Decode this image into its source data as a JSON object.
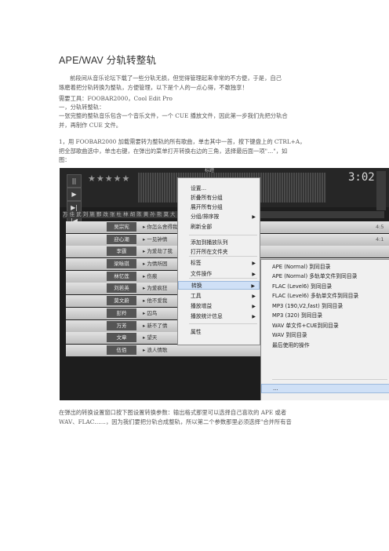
{
  "title": "APE/WAV 分轨转整轨",
  "paragraphs": {
    "p1_a": "前段间从音乐论坛下载了一些分轨无损，但觉得管理起来非常的不方便，于是，自己",
    "p1_b": "琢磨着把分轨转换为整轨，方便管理，以下是个人的一点心得，不敢独享！",
    "tools": "需要工具：FOOBAR2000，Cool Edit Pro",
    "step1": "一，分轨转整轨：",
    "p3_a": "一张完整的整轨音乐包含一个音乐文件，一个 CUE 播放文件，因此第一步我们先把分轨合",
    "p3_b": "并，再制作 CUE 文件。",
    "p4_a": "1，用 FOOBAR2000 加载需要转为整轨的所有歌曲，单击其中一首，按下键盘上的 CTRL+A，",
    "p4_b": "把全部歌曲选中，单击右键，在弹出的菜单打开转换右边的三角，选择最后面一项\"…\"，如",
    "p4_c": "图：",
    "after_a": "在弹出的转换设置窗口按下图设置转换参数：输出格式那里可以选择自己喜欢的 APE 或者",
    "after_b": "WAV、FLAC……，因为我们要把分轨合成整轨，所以第二个参数那里必须选择\"合并所有音"
  },
  "player": {
    "time": "3:02",
    "stars": "★★★★★",
    "top_label": "标题",
    "controls": [
      "||",
      "▶",
      "▶|",
      "|◀"
    ],
    "tabs": "万 佳 武 刘 施 鄞 改 张 杜 林 胡 陈 黄 孙 熊 莫 大 宋 李",
    "tracks": [
      {
        "artist": "吴宗宪",
        "song": "你怎么舍得我难过",
        "duration": "4:5"
      },
      {
        "artist": "迎心潮",
        "song": "一见钟情",
        "duration": "4:1"
      },
      {
        "artist": "李霆",
        "song": "为爱劫了我",
        "duration": ""
      },
      {
        "artist": "梁咏琪",
        "song": "为情所困",
        "duration": ""
      },
      {
        "artist": "林忆莲",
        "song": "伤痕",
        "duration": ""
      },
      {
        "artist": "刘若英",
        "song": "为爱疯狂",
        "duration": ""
      },
      {
        "artist": "莫文蔚",
        "song": "他不爱我",
        "duration": ""
      },
      {
        "artist": "彭羚",
        "song": "囚鸟",
        "duration": ""
      },
      {
        "artist": "万芳",
        "song": "新不了情",
        "duration": ""
      },
      {
        "artist": "文章",
        "song": "望天",
        "duration": ""
      },
      {
        "artist": "伍佰",
        "song": "浪人情歌",
        "duration": ""
      }
    ]
  },
  "context_menu": {
    "items": [
      {
        "label": "设置...",
        "arrow": ""
      },
      {
        "label": "折叠所有分组",
        "arrow": ""
      },
      {
        "label": "展开所有分组",
        "arrow": ""
      },
      {
        "label": "分组/排序按",
        "arrow": "▶"
      },
      {
        "label": "刷新全部",
        "arrow": ""
      },
      {
        "label": "添加到播放队列",
        "arrow": ""
      },
      {
        "label": "打开所在文件夹",
        "arrow": ""
      },
      {
        "label": "标签",
        "arrow": "▶"
      },
      {
        "label": "文件操作",
        "arrow": "▶"
      },
      {
        "label": "转换",
        "arrow": "▶"
      },
      {
        "label": "工具",
        "arrow": "▶"
      },
      {
        "label": "播放增益",
        "arrow": "▶"
      },
      {
        "label": "播放统计信息",
        "arrow": "▶"
      },
      {
        "label": "属性",
        "arrow": ""
      }
    ]
  },
  "convert_menu": {
    "items": [
      "APE (Normal) 到同目录",
      "APE (Normal) 多轨单文件到同目录",
      "FLAC (Level6) 到同目录",
      "FLAC (Level6) 多轨单文件到同目录",
      "MP3 (190,V2,fast) 到同目录",
      "MP3 (320) 到同目录",
      "WAV 单文件+CUE到同目录",
      "WAV 到同目录",
      "最后使用的操作",
      "..."
    ]
  }
}
